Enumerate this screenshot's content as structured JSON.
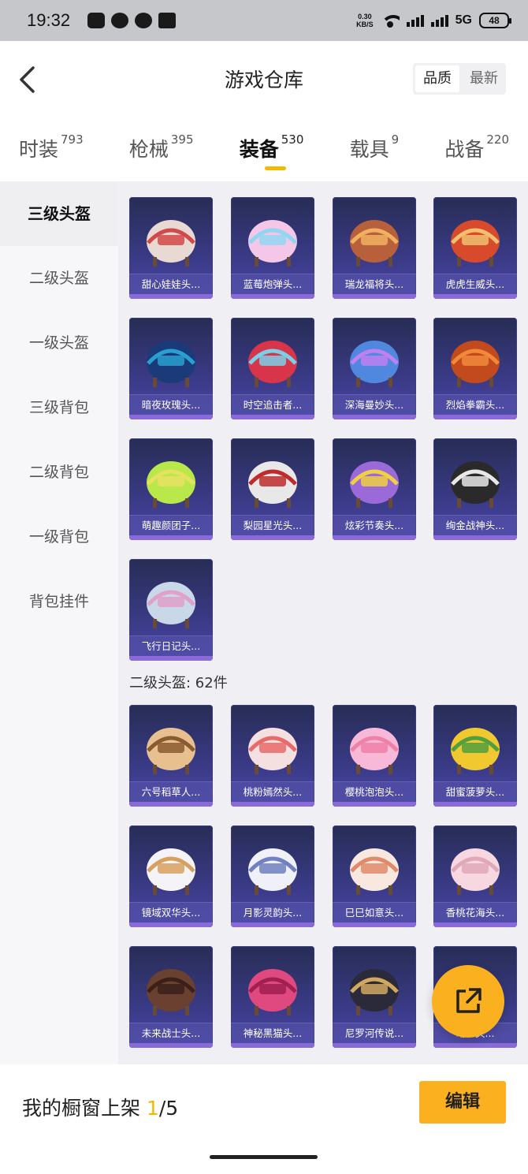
{
  "status_bar": {
    "time": "19:32",
    "net_speed_value": "0.30",
    "net_speed_unit": "KB/S",
    "network": "5G",
    "battery": "48",
    "notification_icons": [
      "message-icon",
      "chat-icon",
      "q-icon",
      "app-icon"
    ]
  },
  "header": {
    "title": "游戏仓库",
    "sort_quality": "品质",
    "sort_newest": "最新",
    "active_sort": "品质"
  },
  "tabs": [
    {
      "label": "时装",
      "count": "793"
    },
    {
      "label": "枪械",
      "count": "395"
    },
    {
      "label": "装备",
      "count": "530"
    },
    {
      "label": "载具",
      "count": "9"
    },
    {
      "label": "战备",
      "count": "220"
    }
  ],
  "active_tab": "装备",
  "sidebar": {
    "items": [
      "三级头盔",
      "二级头盔",
      "一级头盔",
      "三级背包",
      "二级背包",
      "一级背包",
      "背包挂件"
    ],
    "active": "三级头盔"
  },
  "section_level3": {
    "items": [
      "甜心娃娃头...",
      "蓝莓炮弹头...",
      "瑞龙福将头...",
      "虎虎生威头...",
      "暗夜玫瑰头...",
      "时空追击者...",
      "深海曼妙头...",
      "烈焰拳霸头...",
      "萌趣颜团子...",
      "梨园星光头...",
      "炫彩节奏头...",
      "绚金战神头...",
      "飞行日记头..."
    ]
  },
  "section_level2": {
    "label": "二级头盔: 62件",
    "items": [
      "六号稻草人...",
      "桃粉嫣然头...",
      "樱桃泡泡头...",
      "甜蜜菠萝头...",
      "镜域双华头...",
      "月影灵韵头...",
      "巳巳如意头...",
      "香桃花海头...",
      "未来战士头...",
      "神秘黑猫头...",
      "尼罗河传说...",
      "动...头..."
    ]
  },
  "bottom": {
    "showcase_label": "我的橱窗上架",
    "showcase_current": "1",
    "showcase_total": "/5",
    "edit_label": "编辑"
  },
  "colors": {
    "accent": "#fbb01f",
    "card_bg": "#3a3a86"
  }
}
